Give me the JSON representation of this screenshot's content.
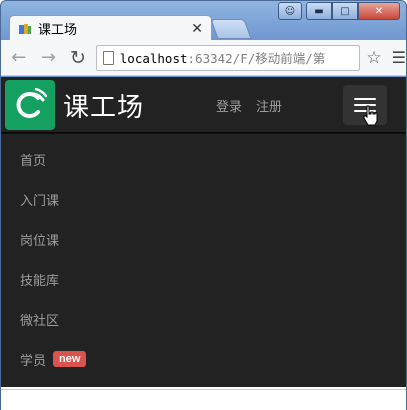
{
  "browser": {
    "tab_title": "课工场",
    "url_host": "localhost",
    "url_rest": ":63342/F/移动前端/第"
  },
  "navbar": {
    "brand_name": "课工场",
    "login": "登录",
    "register": "注册"
  },
  "menu": {
    "items": [
      {
        "label": "首页"
      },
      {
        "label": "入门课"
      },
      {
        "label": "岗位课"
      },
      {
        "label": "技能库"
      },
      {
        "label": "微社区"
      },
      {
        "label": "学员",
        "badge": "new"
      }
    ]
  },
  "colors": {
    "navbar_bg": "#222222",
    "logo_bg": "#14a060",
    "badge_bg": "#d9534f",
    "link": "#9d9d9d"
  }
}
